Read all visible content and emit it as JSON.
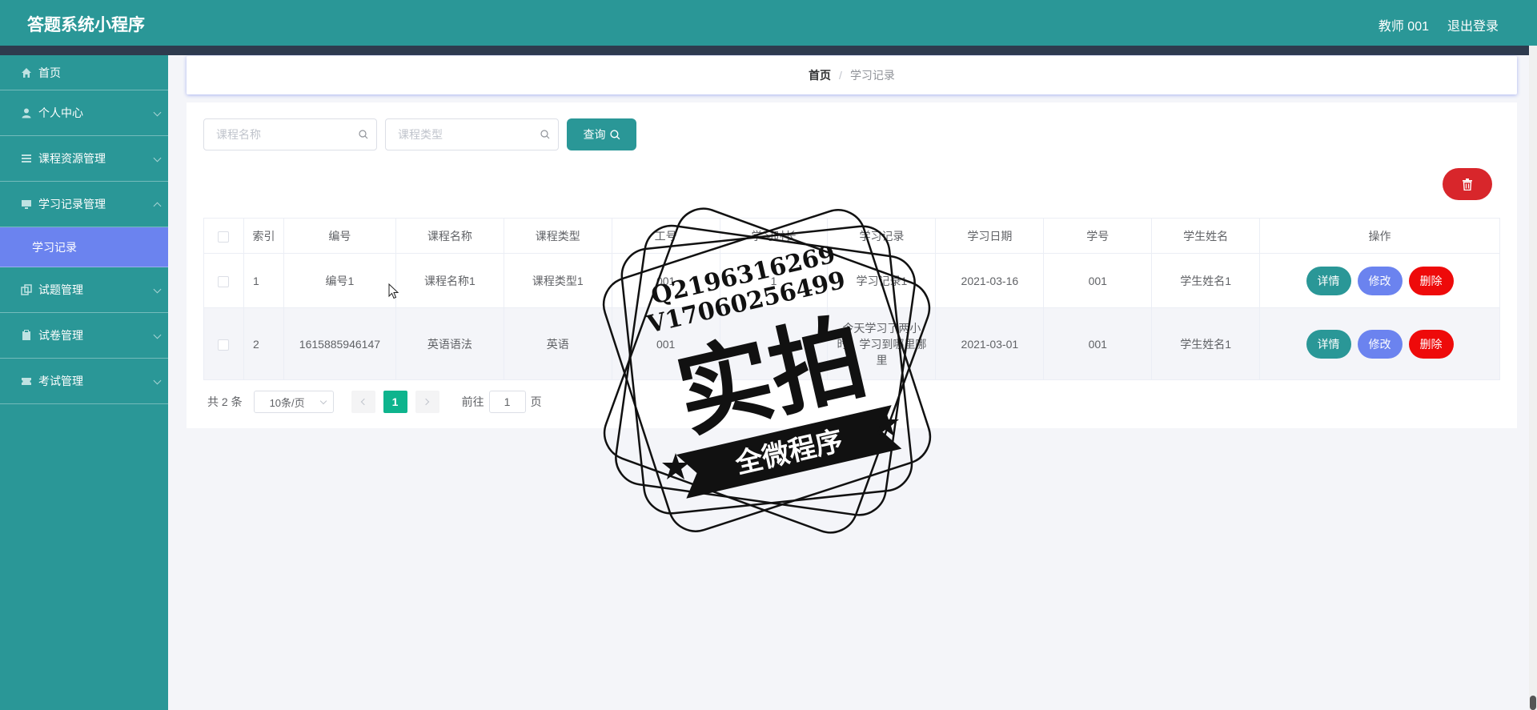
{
  "app": {
    "title": "答题系统小程序",
    "user": "教师 001",
    "logout": "退出登录"
  },
  "sidebar": {
    "items": [
      {
        "label": "首页",
        "icon": "home-icon"
      },
      {
        "label": "个人中心",
        "icon": "user-icon"
      },
      {
        "label": "课程资源管理",
        "icon": "list-icon"
      },
      {
        "label": "学习记录管理",
        "icon": "monitor-icon"
      },
      {
        "label": "试题管理",
        "icon": "copy-icon"
      },
      {
        "label": "试卷管理",
        "icon": "clipboard-icon"
      },
      {
        "label": "考试管理",
        "icon": "ticket-icon"
      }
    ],
    "active_sub": "学习记录"
  },
  "breadcrumb": {
    "home": "首页",
    "separator": "/",
    "current": "学习记录"
  },
  "search": {
    "course_name_placeholder": "课程名称",
    "course_type_placeholder": "课程类型",
    "query_label": "查询"
  },
  "table": {
    "headers": [
      "索引",
      "编号",
      "课程名称",
      "课程类型",
      "工号",
      "学习时长",
      "学习记录",
      "学习日期",
      "学号",
      "学生姓名",
      "操作"
    ],
    "rows": [
      {
        "index": "1",
        "code": "编号1",
        "course_name": "课程名称1",
        "course_type": "课程类型1",
        "work_no": "001",
        "duration": "1",
        "record": "学习记录1",
        "date": "2021-03-16",
        "student_no": "001",
        "student_name": "学生姓名1"
      },
      {
        "index": "2",
        "code": "1615885946147",
        "course_name": "英语语法",
        "course_type": "英语",
        "work_no": "001",
        "duration": "",
        "record": "今天学习了两小时，学习到哪里哪里",
        "date": "2021-03-01",
        "student_no": "001",
        "student_name": "学生姓名1"
      }
    ],
    "actions": {
      "detail": "详情",
      "edit": "修改",
      "delete": "删除"
    }
  },
  "pagination": {
    "total": "共 2 条",
    "page_size": "10条/页",
    "current_page": "1",
    "goto_prefix": "前往",
    "goto_value": "1",
    "goto_suffix": "页"
  },
  "watermark": {
    "line1": "Q2196316269",
    "line2": "V17060256499",
    "main": "实拍",
    "banner": "全微程序"
  },
  "colors": {
    "primary": "#2a9797",
    "edit": "#6b83ef",
    "delete": "#ee0a0a",
    "page_active": "#0eb48d"
  }
}
